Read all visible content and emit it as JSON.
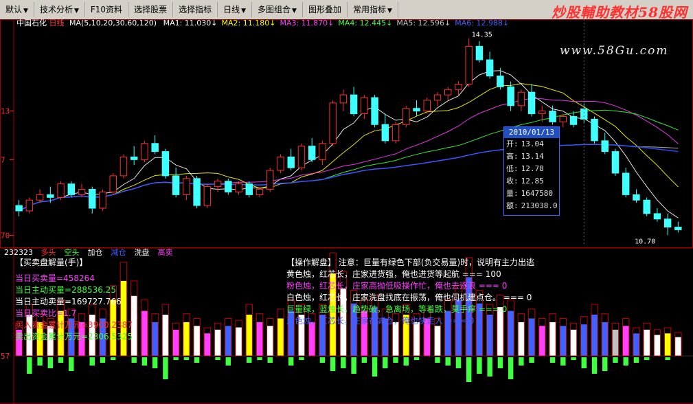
{
  "toolbar": {
    "items": [
      {
        "label": "默认",
        "arrow": "▼"
      },
      {
        "label": "技术分析",
        "arrow": "▼"
      },
      {
        "label": "F10资料",
        "arrow": ""
      },
      {
        "label": "选择股票",
        "arrow": ""
      },
      {
        "label": "选择指标",
        "arrow": ""
      },
      {
        "label": "日线",
        "arrow": "▼"
      },
      {
        "label": "多图组合",
        "arrow": "▼"
      },
      {
        "label": "图形叠加",
        "arrow": ""
      },
      {
        "label": "常用指标",
        "arrow": "▼"
      }
    ]
  },
  "watermark": {
    "title_a": "炒股輔助教材",
    "title_b": "58股网",
    "url": "www.58Gu.com"
  },
  "stock": {
    "name": "中国石化",
    "period": "日线"
  },
  "ma_line": {
    "spec": "MA(5,10,20,30,60,120)",
    "items": [
      {
        "label": "MA1: 11.030↓",
        "color": "#ffffff"
      },
      {
        "label": "MA2: 11.180↓",
        "color": "#ffff00"
      },
      {
        "label": "MA3: 11.870↓",
        "color": "#ff40ff"
      },
      {
        "label": "MA4: 12.445↓",
        "color": "#40ff40"
      },
      {
        "label": "MA5: 12.596↓",
        "color": "#c0c0c0"
      },
      {
        "label": "MA6: 12.988↓",
        "color": "#4060ff"
      }
    ]
  },
  "price_axis": {
    "labels": [
      "13",
      "7",
      "70"
    ]
  },
  "annotations": {
    "high": "14.35",
    "low": "10.70"
  },
  "tooltip": {
    "date": "2010/01/13",
    "rows": [
      {
        "label": "开:",
        "value": "13.04"
      },
      {
        "label": "高:",
        "value": "13.14"
      },
      {
        "label": "低:",
        "value": "12.78"
      },
      {
        "label": "收:",
        "value": "12.85"
      },
      {
        "label": "量:",
        "value": "1647580"
      },
      {
        "label": "额:",
        "value": "213038.0"
      }
    ]
  },
  "sub_header": {
    "code": "232323",
    "items": [
      {
        "label": "多头",
        "color": "#ff3030"
      },
      {
        "label": "空头",
        "color": "#40ff40"
      },
      {
        "label": "加仓",
        "color": "#ffffff"
      },
      {
        "label": "减仓",
        "color": "#4060ff"
      },
      {
        "label": "洗盘",
        "color": "#ffffff"
      },
      {
        "label": "高卖",
        "color": "#ff40ff"
      }
    ]
  },
  "left_panel": {
    "title": "【买卖盘解量(手)】",
    "lines": [
      {
        "text": "当日买卖量=458264",
        "color": "#ff40ff"
      },
      {
        "text": "当日主动买量=288536.25",
        "color": "#40ff40"
      },
      {
        "text": "当日主动卖量=169727.766",
        "color": "#ffffff"
      },
      {
        "text": "当日买卖比=1.7",
        "color": "#ff40ff"
      },
      {
        "text": "买入资金累计万元=3900.2387",
        "color": "#ff3030"
      },
      {
        "text": "卖出资金累计万元=2306.5325",
        "color": "#40ff40"
      }
    ]
  },
  "right_panel": {
    "title": "【操作解盘】 注意：巨量有绿色下部(负交易量)时，说明有主力出逃",
    "lines": [
      {
        "text": "黄色烛，红芯长，庄家进货强，俺也进货等起航 === 100",
        "color": "#ffffff"
      },
      {
        "text": "粉色烛，红芯长，庄家高抛低吸操作忙，俺也去逐浪 === 0",
        "color": "#ff40ff"
      },
      {
        "text": "白色烛，红芯长，庄家洗盘找底在振荡，俺也伺机建点仓。 === 0",
        "color": "#ffffff"
      },
      {
        "text": "巨量绿，蓝烛长，趋势破，急离场，等着跌，莫手痒 === 0",
        "color": "#40ff40"
      },
      {
        "text": "蓝色烛，红芯长，庄家在减仓，俺也快走人 === 0",
        "color": "#4060ff"
      }
    ]
  },
  "volume_axis": {
    "label": "57"
  },
  "chart_data": {
    "type": "candlestick",
    "title": "中国石化 日线",
    "ylim": [
      10.5,
      14.6
    ],
    "candles": [
      [
        11.25,
        11.35,
        11.05,
        11.15
      ],
      [
        11.15,
        11.4,
        11.1,
        11.35
      ],
      [
        11.35,
        11.55,
        11.3,
        11.45
      ],
      [
        11.45,
        11.6,
        11.3,
        11.4
      ],
      [
        11.4,
        11.7,
        11.35,
        11.65
      ],
      [
        11.65,
        11.7,
        11.4,
        11.45
      ],
      [
        11.45,
        11.65,
        11.4,
        11.55
      ],
      [
        11.55,
        11.6,
        11.1,
        11.2
      ],
      [
        11.2,
        11.55,
        11.15,
        11.5
      ],
      [
        11.5,
        11.85,
        11.45,
        11.8
      ],
      [
        11.8,
        12.2,
        11.75,
        12.15
      ],
      [
        12.15,
        12.35,
        12.0,
        12.1
      ],
      [
        12.1,
        12.45,
        12.05,
        12.4
      ],
      [
        12.4,
        12.55,
        12.2,
        12.25
      ],
      [
        12.25,
        12.3,
        11.75,
        11.8
      ],
      [
        11.8,
        11.95,
        11.4,
        11.45
      ],
      [
        11.45,
        11.8,
        11.35,
        11.75
      ],
      [
        11.75,
        11.8,
        11.2,
        11.25
      ],
      [
        11.25,
        11.65,
        11.2,
        11.6
      ],
      [
        11.6,
        11.75,
        11.5,
        11.7
      ],
      [
        11.7,
        11.75,
        11.45,
        11.5
      ],
      [
        11.5,
        11.7,
        11.45,
        11.65
      ],
      [
        11.65,
        11.7,
        11.4,
        11.45
      ],
      [
        11.45,
        11.6,
        11.4,
        11.55
      ],
      [
        11.55,
        11.95,
        11.5,
        11.9
      ],
      [
        11.9,
        12.2,
        11.85,
        12.15
      ],
      [
        12.15,
        12.3,
        11.9,
        11.95
      ],
      [
        11.95,
        12.4,
        11.9,
        12.35
      ],
      [
        12.35,
        12.5,
        12.05,
        12.1
      ],
      [
        12.1,
        12.45,
        12.0,
        12.4
      ],
      [
        12.4,
        13.2,
        12.35,
        13.15
      ],
      [
        13.15,
        13.4,
        13.0,
        13.3
      ],
      [
        13.3,
        13.45,
        12.9,
        12.95
      ],
      [
        12.95,
        13.3,
        12.85,
        13.25
      ],
      [
        13.25,
        13.3,
        12.7,
        12.75
      ],
      [
        12.75,
        12.95,
        12.4,
        12.45
      ],
      [
        12.45,
        12.8,
        12.4,
        12.75
      ],
      [
        12.75,
        13.1,
        12.7,
        13.05
      ],
      [
        13.05,
        13.2,
        12.9,
        13.0
      ],
      [
        13.0,
        13.25,
        12.95,
        13.2
      ],
      [
        13.2,
        13.35,
        13.1,
        13.3
      ],
      [
        13.3,
        13.45,
        13.2,
        13.4
      ],
      [
        13.4,
        13.55,
        13.3,
        13.5
      ],
      [
        13.5,
        14.35,
        13.45,
        14.2
      ],
      [
        14.2,
        14.3,
        13.9,
        13.95
      ],
      [
        13.95,
        14.1,
        13.6,
        13.65
      ],
      [
        13.65,
        13.8,
        13.4,
        13.45
      ],
      [
        13.45,
        13.55,
        13.0,
        13.1
      ],
      [
        13.1,
        13.4,
        13.0,
        13.35
      ],
      [
        13.35,
        13.5,
        12.9,
        12.95
      ],
      [
        12.95,
        13.1,
        12.8,
        13.0
      ],
      [
        13.0,
        13.1,
        12.75,
        12.8
      ],
      [
        12.8,
        12.95,
        12.7,
        12.9
      ],
      [
        12.9,
        13.0,
        12.7,
        12.75
      ],
      [
        13.04,
        13.14,
        12.78,
        12.85
      ],
      [
        12.85,
        12.9,
        12.4,
        12.45
      ],
      [
        12.45,
        12.6,
        12.2,
        12.25
      ],
      [
        12.25,
        12.3,
        11.8,
        11.85
      ],
      [
        11.85,
        11.95,
        11.4,
        11.45
      ],
      [
        11.45,
        11.55,
        11.3,
        11.35
      ],
      [
        11.35,
        11.4,
        11.05,
        11.1
      ],
      [
        11.1,
        11.2,
        10.95,
        11.0
      ],
      [
        11.0,
        11.1,
        10.7,
        10.85
      ],
      [
        10.85,
        10.95,
        10.75,
        10.8
      ]
    ],
    "volume": [
      {
        "v": 0.35,
        "c": "#ff40ff",
        "n": 0.0
      },
      {
        "v": 0.55,
        "c": "#ffffff",
        "n": 0.6
      },
      {
        "v": 0.45,
        "c": "#ffff00",
        "n": 0.3
      },
      {
        "v": 0.4,
        "c": "#ffffff",
        "n": 0.4
      },
      {
        "v": 0.6,
        "c": "#ffff00",
        "n": 0.2
      },
      {
        "v": 0.5,
        "c": "#4060ff",
        "n": 0.5
      },
      {
        "v": 0.45,
        "c": "#ff40ff",
        "n": 0.0
      },
      {
        "v": 0.55,
        "c": "#ffffff",
        "n": 0.3
      },
      {
        "v": 0.5,
        "c": "#4060ff",
        "n": 0.2
      },
      {
        "v": 0.75,
        "c": "#ffff00",
        "n": 0.1
      },
      {
        "v": 1.0,
        "c": "#ffff00",
        "n": 0.0
      },
      {
        "v": 0.8,
        "c": "#ffffff",
        "n": 0.2
      },
      {
        "v": 0.6,
        "c": "#ff40ff",
        "n": 0.3
      },
      {
        "v": 0.45,
        "c": "#4060ff",
        "n": 0.4
      },
      {
        "v": 0.55,
        "c": "#ffffff",
        "n": 0.8
      },
      {
        "v": 0.35,
        "c": "#ff40ff",
        "n": 0.1
      },
      {
        "v": 0.45,
        "c": "#ffff00",
        "n": 0.1
      },
      {
        "v": 0.4,
        "c": "#ffffff",
        "n": 0.2
      },
      {
        "v": 0.3,
        "c": "#ff40ff",
        "n": 0.0
      },
      {
        "v": 0.35,
        "c": "#ffffff",
        "n": 0.1
      },
      {
        "v": 0.4,
        "c": "#4060ff",
        "n": 0.3
      },
      {
        "v": 0.38,
        "c": "#ffffff",
        "n": 0.0
      },
      {
        "v": 0.55,
        "c": "#ffff00",
        "n": 0.2
      },
      {
        "v": 0.45,
        "c": "#ff40ff",
        "n": 0.1
      },
      {
        "v": 0.4,
        "c": "#ffffff",
        "n": 0.2
      },
      {
        "v": 0.5,
        "c": "#ffff00",
        "n": 0.0
      },
      {
        "v": 0.6,
        "c": "#4060ff",
        "n": 0.3
      },
      {
        "v": 0.55,
        "c": "#ffffff",
        "n": 0.1
      },
      {
        "v": 0.45,
        "c": "#ff40ff",
        "n": 0.0
      },
      {
        "v": 0.55,
        "c": "#4060ff",
        "n": 0.2
      },
      {
        "v": 1.1,
        "c": "#ffff00",
        "n": 0.5
      },
      {
        "v": 0.9,
        "c": "#ffffff",
        "n": 0.4
      },
      {
        "v": 0.7,
        "c": "#4060ff",
        "n": 0.6
      },
      {
        "v": 0.6,
        "c": "#ff40ff",
        "n": 0.2
      },
      {
        "v": 0.65,
        "c": "#4060ff",
        "n": 0.7
      },
      {
        "v": 0.5,
        "c": "#4060ff",
        "n": 0.4
      },
      {
        "v": 0.45,
        "c": "#ffffff",
        "n": 0.2
      },
      {
        "v": 0.55,
        "c": "#ffff00",
        "n": 0.3
      },
      {
        "v": 0.45,
        "c": "#ffffff",
        "n": 0.1
      },
      {
        "v": 0.5,
        "c": "#ff40ff",
        "n": 0.0
      },
      {
        "v": 0.4,
        "c": "#ffffff",
        "n": 0.2
      },
      {
        "v": 0.6,
        "c": "#4060ff",
        "n": 0.3
      },
      {
        "v": 0.75,
        "c": "#4060ff",
        "n": 0.4
      },
      {
        "v": 1.05,
        "c": "#4060ff",
        "n": 0.9
      },
      {
        "v": 0.7,
        "c": "#4060ff",
        "n": 0.6
      },
      {
        "v": 0.55,
        "c": "#4060ff",
        "n": 0.7
      },
      {
        "v": 0.65,
        "c": "#ffffff",
        "n": 0.4
      },
      {
        "v": 0.6,
        "c": "#4060ff",
        "n": 0.8
      },
      {
        "v": 0.45,
        "c": "#ffffff",
        "n": 0.3
      },
      {
        "v": 0.5,
        "c": "#4060ff",
        "n": 0.2
      },
      {
        "v": 0.4,
        "c": "#ff40ff",
        "n": 0.0
      },
      {
        "v": 0.45,
        "c": "#ffffff",
        "n": 0.2
      },
      {
        "v": 0.4,
        "c": "#4060ff",
        "n": 0.3
      },
      {
        "v": 0.35,
        "c": "#ffffff",
        "n": 0.1
      },
      {
        "v": 0.42,
        "c": "#4060ff",
        "n": 0.4
      },
      {
        "v": 0.55,
        "c": "#4060ff",
        "n": 0.6
      },
      {
        "v": 0.45,
        "c": "#4060ff",
        "n": 0.5
      },
      {
        "v": 0.35,
        "c": "#c0c0c0",
        "n": 0.2
      },
      {
        "v": 0.4,
        "c": "#ff40ff",
        "n": 0.3
      },
      {
        "v": 0.3,
        "c": "#4060ff",
        "n": 0.2
      },
      {
        "v": 0.35,
        "c": "#ffffff",
        "n": 0.1
      },
      {
        "v": 0.28,
        "c": "#ffffff",
        "n": 0.0
      },
      {
        "v": 0.3,
        "c": "#ffff00",
        "n": 0.1
      },
      {
        "v": 0.25,
        "c": "#ffffff",
        "n": 0.0
      }
    ]
  }
}
